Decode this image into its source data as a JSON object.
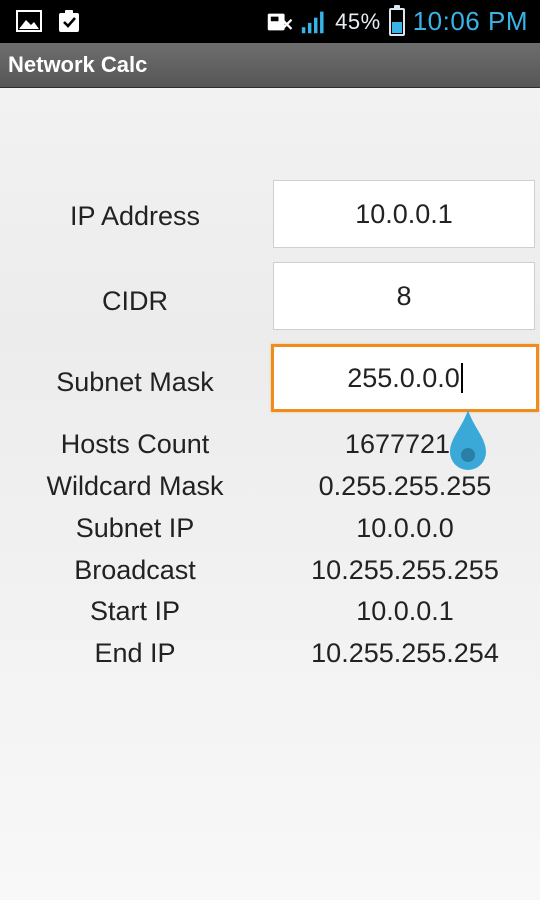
{
  "status_bar": {
    "left_icons": [
      "picture-icon",
      "clipboard-check-icon"
    ],
    "right_icons": [
      "sd-card-icon",
      "signal-icon",
      "battery-icon"
    ],
    "battery_percent": "45%",
    "battery_level": 0.45,
    "time": "10:06 PM"
  },
  "app": {
    "title": "Network Calc"
  },
  "form": {
    "ip_address": {
      "label": "IP Address",
      "value": "10.0.0.1"
    },
    "cidr": {
      "label": "CIDR",
      "value": "8"
    },
    "subnet_mask": {
      "label": "Subnet Mask",
      "value": "255.0.0.0"
    }
  },
  "results": [
    {
      "label": "Hosts Count",
      "value": "16777214"
    },
    {
      "label": "Wildcard Mask",
      "value": "0.255.255.255"
    },
    {
      "label": "Subnet IP",
      "value": "10.0.0.0"
    },
    {
      "label": "Broadcast",
      "value": "10.255.255.255"
    },
    {
      "label": "Start IP",
      "value": "10.0.0.1"
    },
    {
      "label": "End IP",
      "value": "10.255.255.254"
    }
  ],
  "colors": {
    "accent": "#37b3e6",
    "focus_border": "#f08b1d"
  }
}
